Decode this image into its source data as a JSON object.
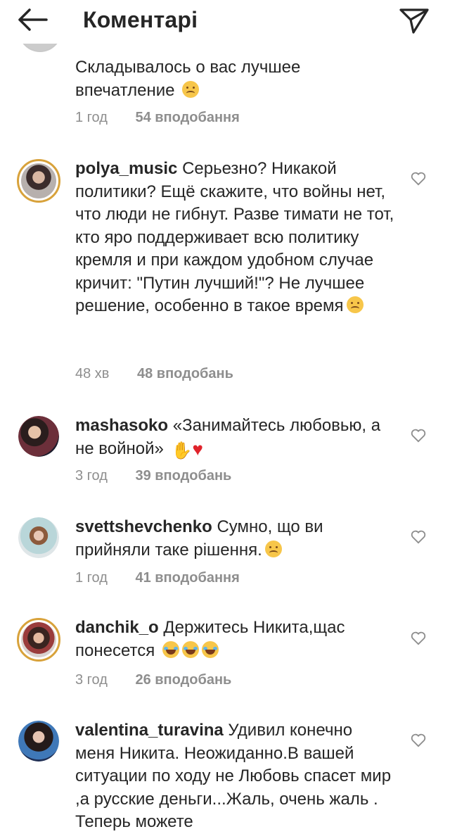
{
  "header": {
    "title": "Коментарі",
    "back_icon": "arrow-left-icon",
    "send_icon": "paper-plane-icon"
  },
  "comments": [
    {
      "text": "Складывалось о вас лучшее впечатление",
      "emoji": "crying-face",
      "time": "1 год",
      "likes": "54 вподобання"
    },
    {
      "username": "polya_music",
      "text": "Серьезно? Никакой политики? Ещё скажите, что войны нет, что люди не гибнут. Разве тимати не тот, кто яро поддерживает всю политику кремля и при каждом удобном случае кричит: \"Путин лучший!\"? Не лучшее решение, особенно в такое время",
      "emoji": "crying-face",
      "time": "48 хв",
      "likes": "48 вподобань"
    },
    {
      "username": "mashasoko",
      "text": "«Занимайтесь любовью, а не войной»",
      "emoji": "raised-hands red-heart",
      "time": "3 год",
      "likes": "39 вподобань"
    },
    {
      "username": "svettshevchenko",
      "text": "Сумно, що ви прийняли таке рішення.",
      "emoji": "frowning-face",
      "time": "1 год",
      "likes": "41 вподобання"
    },
    {
      "username": "danchik_o",
      "text": "Держитесь Никита,щас понесется",
      "emoji": "tears-of-joy x3",
      "time": "3 год",
      "likes": "26 вподобань"
    },
    {
      "username": "valentina_turavina",
      "text": "Удивил конечно меня Никита. Неожиданно.В вашей ситуации по ходу не Любовь спасет мир ,а русские деньги...Жаль, очень жаль . Теперь можете"
    }
  ],
  "colors": {
    "text": "#262626",
    "meta": "#8e8e8e",
    "story_ring": "#d8a23b",
    "heart": "#e0232b"
  }
}
